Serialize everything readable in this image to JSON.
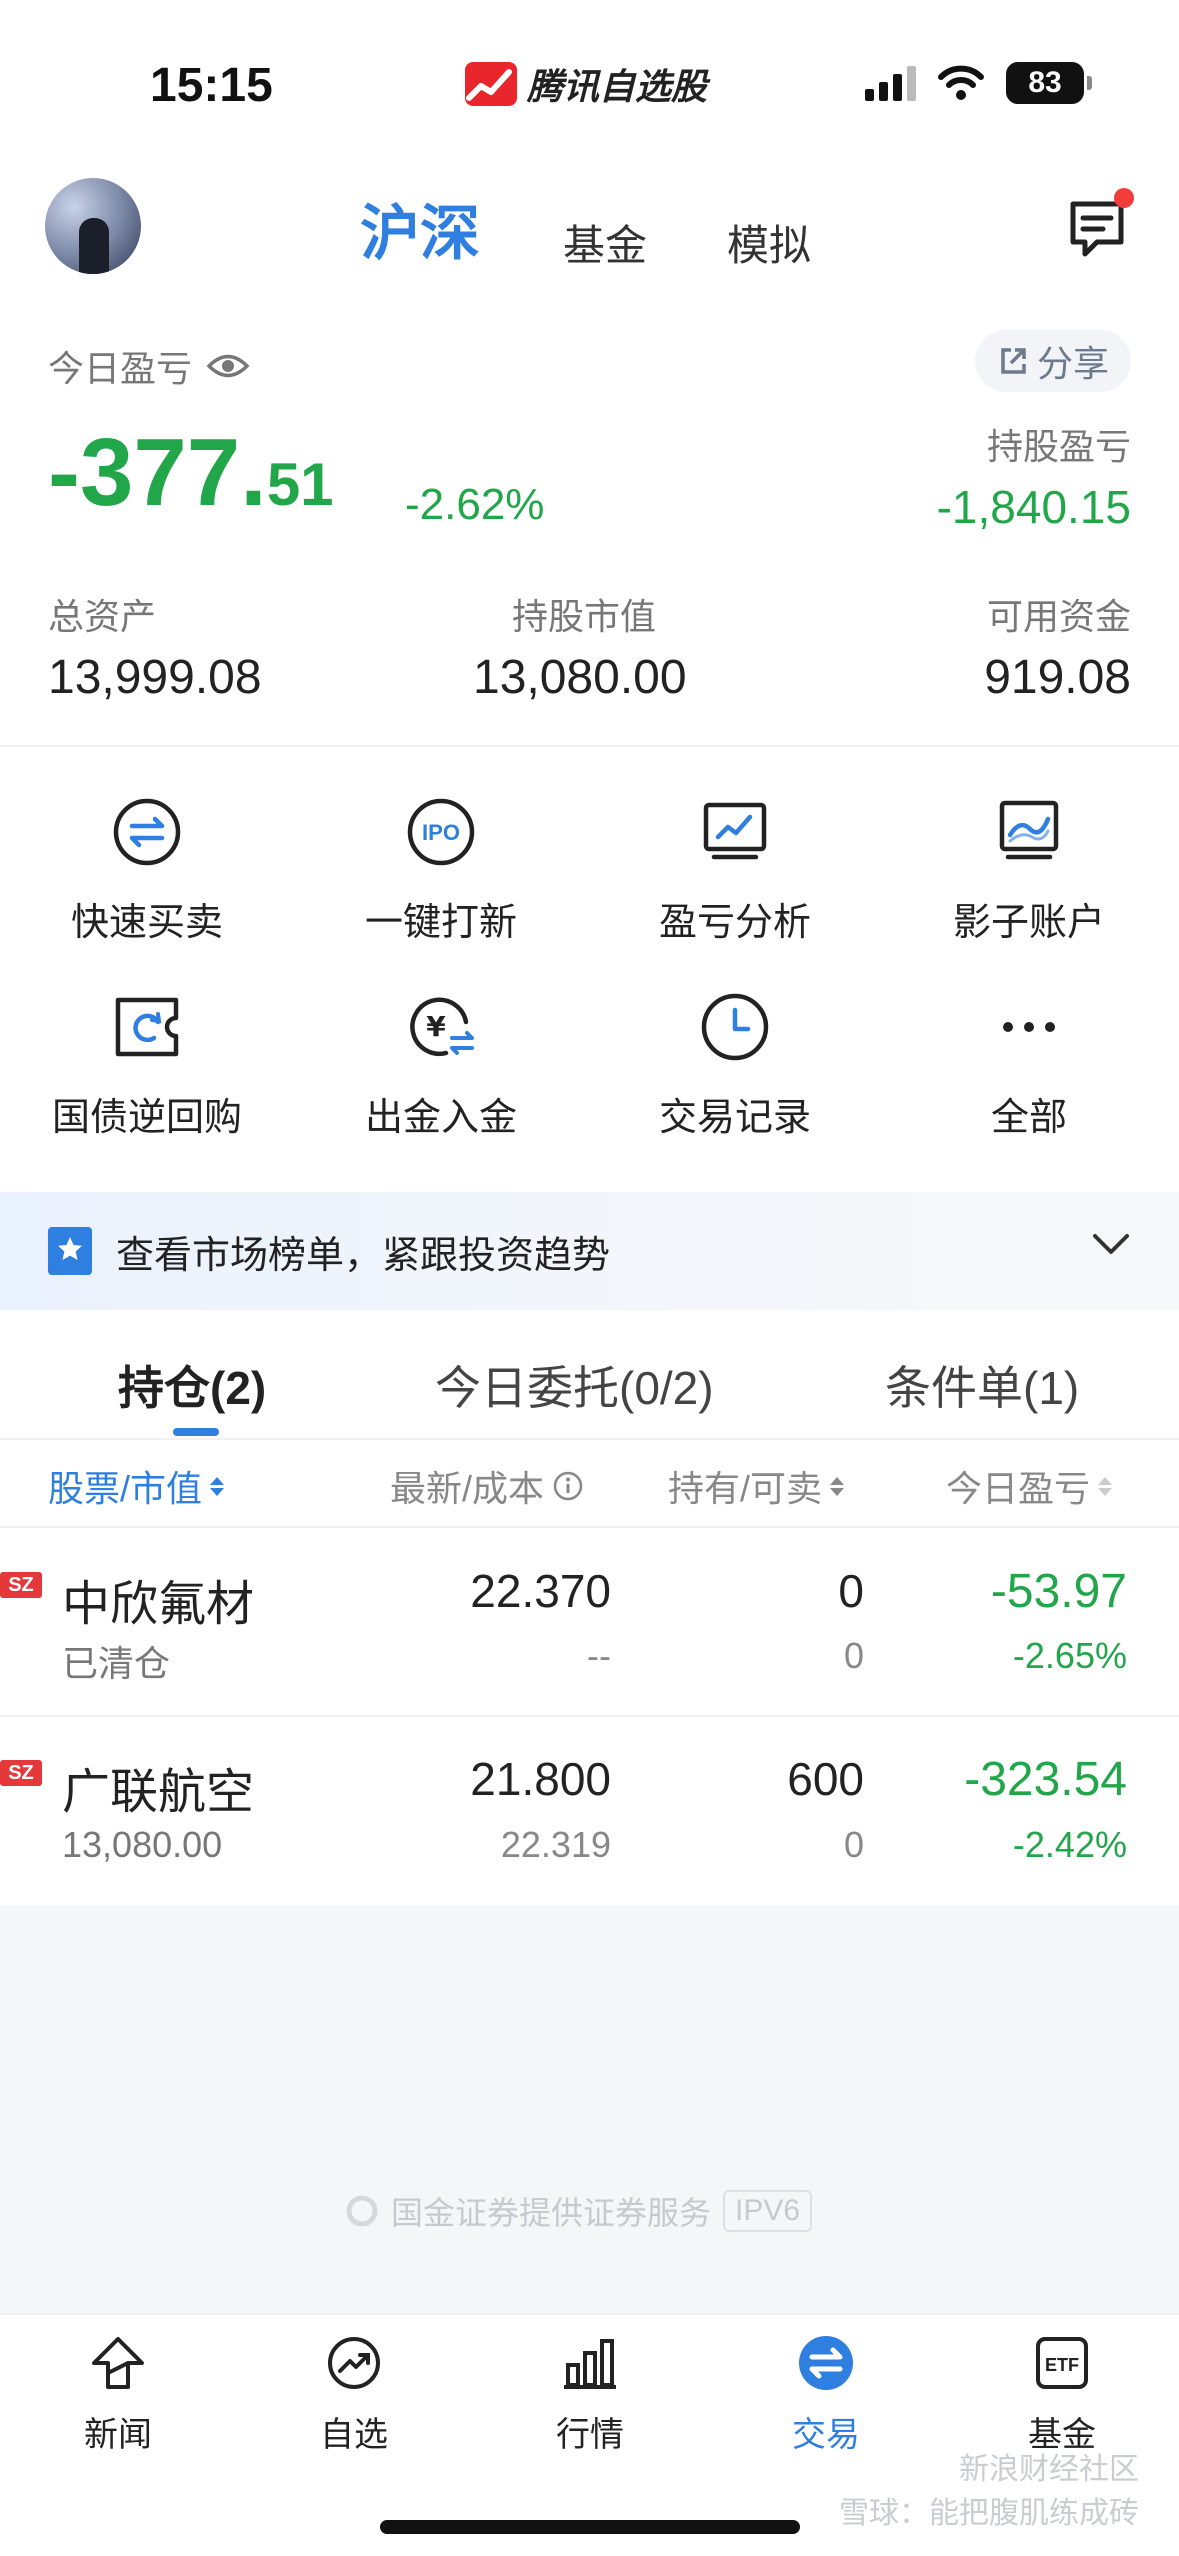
{
  "status_bar": {
    "time": "15:15",
    "app_name": "腾讯自选股",
    "battery": "83"
  },
  "header": {
    "tabs": [
      {
        "label": "沪深",
        "active": true
      },
      {
        "label": "基金",
        "active": false
      },
      {
        "label": "模拟",
        "active": false
      }
    ]
  },
  "summary": {
    "today_pnl_label": "今日盈亏",
    "share_label": "分享",
    "today_pnl_int": "-377.",
    "today_pnl_dec": "51",
    "today_pnl_pct": "-2.62%",
    "holding_pnl_label": "持股盈亏",
    "holding_pnl_value": "-1,840.15",
    "total_assets_label": "总资产",
    "total_assets_value": "13,999.08",
    "market_value_label": "持股市值",
    "market_value_value": "13,080.00",
    "available_cash_label": "可用资金",
    "available_cash_value": "919.08"
  },
  "quick_actions": [
    {
      "label": "快速买卖",
      "icon": "swap-icon"
    },
    {
      "label": "一键打新",
      "icon": "ipo-icon"
    },
    {
      "label": "盈亏分析",
      "icon": "chart-monitor-icon"
    },
    {
      "label": "影子账户",
      "icon": "shadow-account-icon"
    },
    {
      "label": "国债逆回购",
      "icon": "bond-repo-icon"
    },
    {
      "label": "出金入金",
      "icon": "yuan-transfer-icon"
    },
    {
      "label": "交易记录",
      "icon": "clock-icon"
    },
    {
      "label": "全部",
      "icon": "more-icon"
    }
  ],
  "banner": {
    "text": "查看市场榜单，紧跟投资趋势"
  },
  "position_tabs": [
    {
      "label": "持仓(2)",
      "active": true
    },
    {
      "label": "今日委托(0/2)",
      "active": false
    },
    {
      "label": "条件单(1)",
      "active": false
    }
  ],
  "table": {
    "headers": [
      "股票/市值",
      "最新/成本",
      "持有/可卖",
      "今日盈亏"
    ],
    "rows": [
      {
        "market": "SZ",
        "name": "中欣氟材",
        "sub": "已清仓",
        "price": "22.370",
        "cost": "--",
        "hold": "0",
        "sellable": "0",
        "pnl": "-53.97",
        "pnl_pct": "-2.65%"
      },
      {
        "market": "SZ",
        "name": "广联航空",
        "sub": "13,080.00",
        "price": "21.800",
        "cost": "22.319",
        "hold": "600",
        "sellable": "0",
        "pnl": "-323.54",
        "pnl_pct": "-2.42%"
      }
    ]
  },
  "footer": {
    "note": "国金证券提供证券服务",
    "badge": "IPV6"
  },
  "bottom_nav": [
    {
      "label": "新闻",
      "icon": "news-icon",
      "active": false
    },
    {
      "label": "自选",
      "icon": "watchlist-icon",
      "active": false
    },
    {
      "label": "行情",
      "icon": "market-icon",
      "active": false
    },
    {
      "label": "交易",
      "icon": "trade-icon",
      "active": true
    },
    {
      "label": "基金",
      "icon": "etf-icon",
      "active": false
    }
  ],
  "watermark": {
    "line1": "新浪财经社区",
    "line2": "雪球：能把腹肌练成砖"
  },
  "colors": {
    "accent": "#2f7fe0",
    "loss_green": "#22a64a",
    "tag_red": "#e5383b"
  }
}
